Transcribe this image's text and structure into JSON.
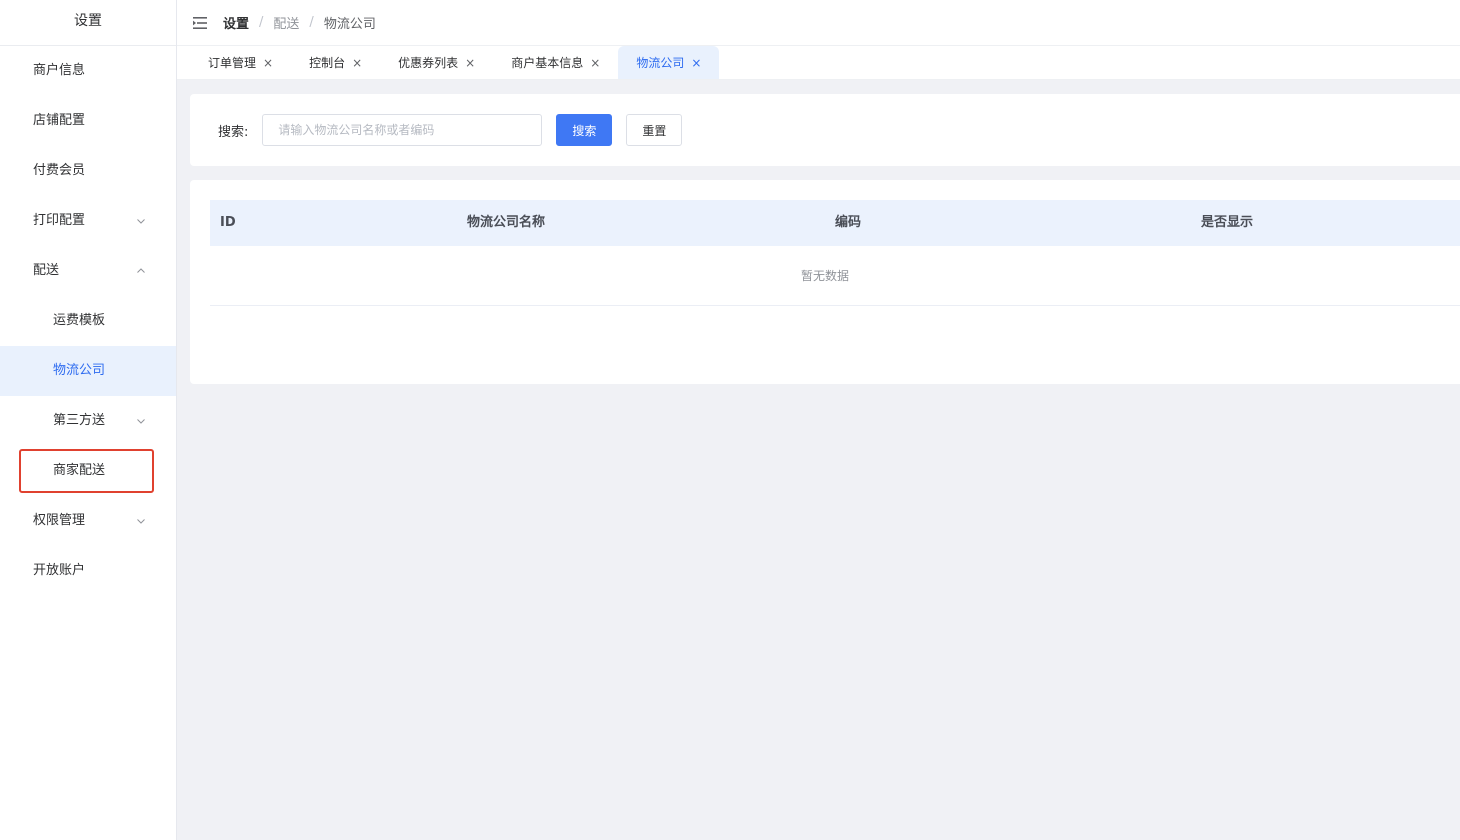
{
  "sidebar": {
    "title": "设置",
    "items": [
      {
        "label": "商户信息"
      },
      {
        "label": "店铺配置"
      },
      {
        "label": "付费会员"
      },
      {
        "label": "打印配置"
      },
      {
        "label": "配送"
      },
      {
        "label": "运费模板"
      },
      {
        "label": "物流公司"
      },
      {
        "label": "第三方送"
      },
      {
        "label": "商家配送"
      },
      {
        "label": "权限管理"
      },
      {
        "label": "开放账户"
      }
    ]
  },
  "breadcrumb": {
    "items": [
      "设置",
      "配送",
      "物流公司"
    ],
    "separator": "/"
  },
  "tabs": [
    {
      "label": "订单管理"
    },
    {
      "label": "控制台"
    },
    {
      "label": "优惠券列表"
    },
    {
      "label": "商户基本信息"
    },
    {
      "label": "物流公司"
    }
  ],
  "tab_close_glyph": "×",
  "search": {
    "label": "搜索:",
    "placeholder": "请输入物流公司名称或者编码",
    "value": "",
    "search_button": "搜索",
    "reset_button": "重置"
  },
  "table": {
    "columns": [
      "ID",
      "物流公司名称",
      "编码",
      "是否显示"
    ],
    "rows": [],
    "empty_text": "暂无数据"
  },
  "colors": {
    "primary": "#3f78f4",
    "active_text": "#2d6bf0",
    "active_bg": "#e9f1fd",
    "highlight_border": "#e0412f"
  },
  "icons": {
    "menu_toggle": "menu-fold-icon",
    "expand": "chevron-down-icon",
    "collapse": "chevron-up-icon",
    "tab_close": "close-icon"
  }
}
